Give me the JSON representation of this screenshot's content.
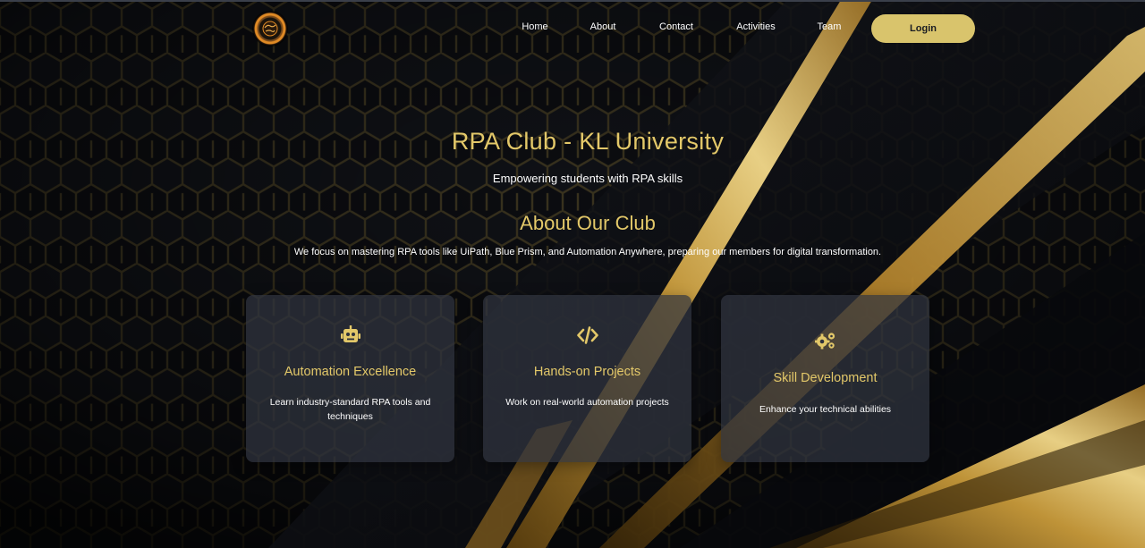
{
  "nav": {
    "links": [
      "Home",
      "About",
      "Contact",
      "Activities",
      "Team"
    ],
    "login_label": "Login"
  },
  "hero": {
    "title": "RPA Club - KL University",
    "subtitle": "Empowering students with RPA skills"
  },
  "about": {
    "title": "About Our Club",
    "text": "We focus on mastering RPA tools like UiPath, Blue Prism, and Automation Anywhere, preparing our members for digital transformation."
  },
  "cards": [
    {
      "icon": "robot-icon",
      "title": "Automation Excellence",
      "text": "Learn industry-standard RPA tools and techniques"
    },
    {
      "icon": "code-icon",
      "title": "Hands-on Projects",
      "text": "Work on real-world automation projects"
    },
    {
      "icon": "gears-icon",
      "title": "Skill Development",
      "text": "Enhance your technical abilities"
    }
  ],
  "colors": {
    "accent": "#e3c869",
    "button": "#d9c46c",
    "background": "#0b0c10"
  }
}
